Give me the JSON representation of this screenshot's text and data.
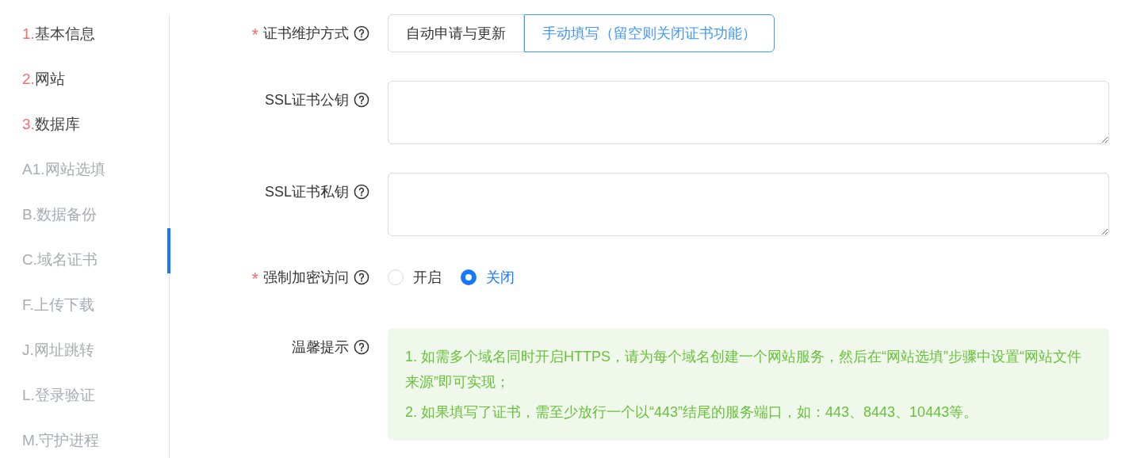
{
  "sidebar": {
    "items": [
      {
        "number": "1.",
        "label": "基本信息",
        "required": true,
        "selected": false
      },
      {
        "number": "2.",
        "label": "网站",
        "required": true,
        "selected": false
      },
      {
        "number": "3.",
        "label": "数据库",
        "required": true,
        "selected": false
      },
      {
        "number": "A1.",
        "label": "网站选填",
        "required": false,
        "selected": false
      },
      {
        "number": "B.",
        "label": "数据备份",
        "required": false,
        "selected": false
      },
      {
        "number": "C.",
        "label": "域名证书",
        "required": false,
        "selected": true
      },
      {
        "number": "F.",
        "label": "上传下载",
        "required": false,
        "selected": false
      },
      {
        "number": "J.",
        "label": "网址跳转",
        "required": false,
        "selected": false
      },
      {
        "number": "L.",
        "label": "登录验证",
        "required": false,
        "selected": false
      },
      {
        "number": "M.",
        "label": "守护进程",
        "required": false,
        "selected": false
      }
    ]
  },
  "form": {
    "required_mark": "*",
    "fields": [
      {
        "kind": "segmented",
        "label": "证书维护方式",
        "required": true,
        "options": [
          {
            "label": "自动申请与更新",
            "selected": false
          },
          {
            "label": "手动填写（留空则关闭证书功能）",
            "selected": true
          }
        ]
      },
      {
        "kind": "textarea",
        "label": "SSL证书公钥",
        "required": false
      },
      {
        "kind": "textarea",
        "label": "SSL证书私钥",
        "required": false
      },
      {
        "kind": "radio",
        "label": "强制加密访问",
        "required": true,
        "options": [
          {
            "label": "开启",
            "selected": false
          },
          {
            "label": "关闭",
            "selected": true
          }
        ]
      },
      {
        "kind": "tip",
        "label": "温馨提示",
        "required": false,
        "lines": [
          "1. 如需多个域名同时开启HTTPS，请为每个域名创建一个网站服务，然后在“网站选填”步骤中设置“网站文件来源”即可实现；",
          "2. 如果填写了证书，需至少放行一个以“443”结尾的服务端口，如：443、8443、10443等。"
        ]
      }
    ]
  }
}
